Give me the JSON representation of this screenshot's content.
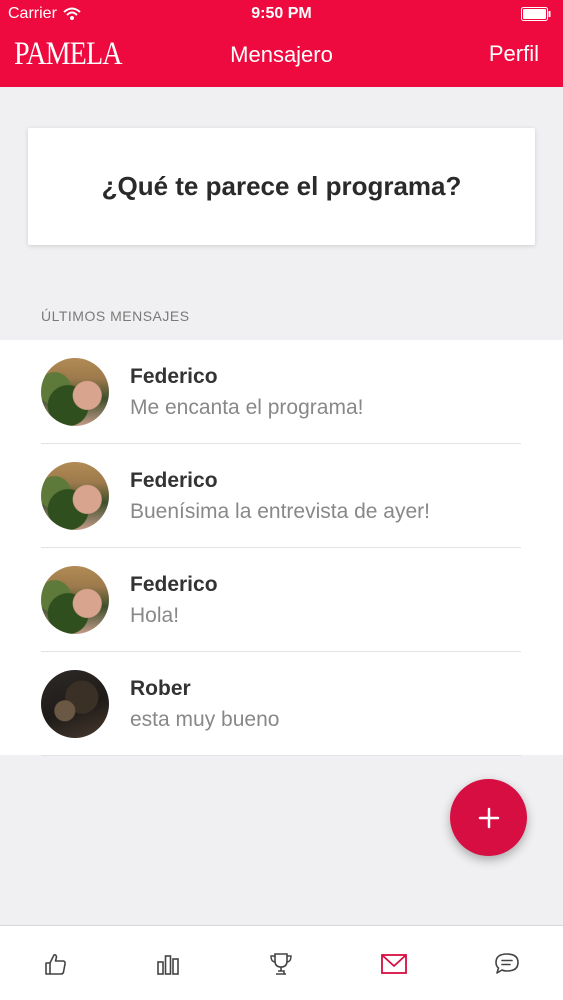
{
  "status_bar": {
    "carrier": "Carrier",
    "time": "9:50 PM"
  },
  "header": {
    "brand": "PAMELA",
    "title": "Mensajero",
    "right_action": "Perfil",
    "background_color": "#ee0a3e"
  },
  "question": {
    "text": "¿Qué te parece el programa?"
  },
  "messages_section": {
    "label": "ÚLTIMOS MENSAJES",
    "items": [
      {
        "name": "Federico",
        "text": "Me encanta el programa!"
      },
      {
        "name": "Federico",
        "text": "Buenísima la entrevista de ayer!"
      },
      {
        "name": "Federico",
        "text": "Hola!"
      },
      {
        "name": "Rober",
        "text": "esta muy bueno"
      }
    ]
  },
  "fab": {
    "icon": "plus-icon",
    "color": "#d70e42"
  },
  "tabbar": {
    "active_color": "#d70e42",
    "items": [
      {
        "icon": "thumbs-up-icon"
      },
      {
        "icon": "bar-chart-icon"
      },
      {
        "icon": "trophy-icon"
      },
      {
        "icon": "mail-icon",
        "active": true
      },
      {
        "icon": "chat-bubble-icon"
      }
    ]
  }
}
